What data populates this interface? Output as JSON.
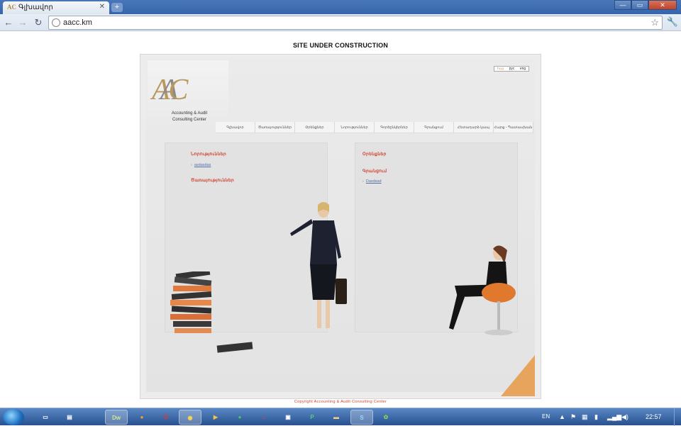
{
  "browser": {
    "tab_title": "Գլխավոր",
    "new_tab_label": "+",
    "url": "aacc.km",
    "icons": {
      "back": "back-arrow-icon",
      "forward": "forward-arrow-icon",
      "reload": "reload-icon",
      "star": "star-icon",
      "wrench": "wrench-icon"
    }
  },
  "page": {
    "construction_notice": "SITE UNDER CONSTRUCTION",
    "logo": {
      "letters": [
        "A",
        "A",
        "C"
      ],
      "name_line1": "Accounting & Audit",
      "name_line2": "Consulting Center"
    },
    "languages": [
      {
        "label": "հայ",
        "active": true
      },
      {
        "label": "рус",
        "active": false
      },
      {
        "label": "eng",
        "active": false
      }
    ],
    "nav": [
      "Գլխավոր",
      "Ծառայություններ",
      "Օրենքներ",
      "Նորություններ",
      "Գործընկերներ",
      "Գրանցում",
      "Հետադարձ կապ",
      "Հարց - Պատասխան"
    ],
    "left_panel": {
      "heading1": "Նորություններ",
      "link1": "asdasdas",
      "heading2": "Ծառայություններ"
    },
    "right_panel": {
      "heading1": "Օրենքներ",
      "heading2": "Գրանցում",
      "link1": "Dasdasd"
    },
    "copyright": "Copyright Accounting & Audit Consulting Center"
  },
  "taskbar": {
    "language": "EN",
    "time": "22:57"
  }
}
